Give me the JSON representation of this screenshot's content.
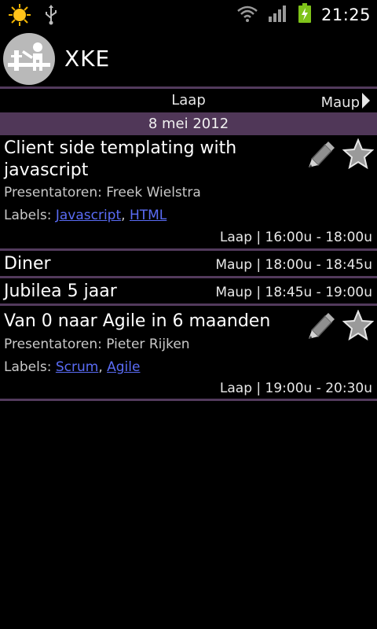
{
  "status_bar": {
    "time": "21:25",
    "icons": [
      "weather-sun-icon",
      "usb-icon",
      "wifi-icon",
      "signal-icon",
      "battery-charging-icon"
    ]
  },
  "app": {
    "title": "XKE",
    "icon": "app-logo-icon"
  },
  "room_nav": {
    "current": "Laap",
    "next": "Maup"
  },
  "date_header": "8 mei 2012",
  "sessions": [
    {
      "title": "Client side templating with javascript",
      "title_line1": "Client side templating with",
      "title_line2": "javascript",
      "presenters": "Presentatoren: Freek Wielstra",
      "labels_prefix": "Labels:",
      "labels": [
        "Javascript",
        "HTML"
      ],
      "meta": "Laap | 16:00u - 18:00u",
      "has_actions": true
    },
    {
      "title": "Diner",
      "meta": "Maup | 18:00u - 18:45u",
      "has_actions": false
    },
    {
      "title": "Jubilea 5 jaar",
      "meta": "Maup | 18:45u - 19:00u",
      "has_actions": false
    },
    {
      "title": "Van 0 naar Agile in 6 maanden",
      "presenters": "Presentatoren: Pieter Rijken",
      "labels_prefix": "Labels:",
      "labels": [
        "Scrum",
        "Agile"
      ],
      "meta": "Laap | 19:00u - 20:30u",
      "has_actions": true
    }
  ],
  "colors": {
    "background": "#000000",
    "accent_purple": "#523a5c",
    "date_header_bg": "#503758",
    "link": "#5a6cf5"
  }
}
